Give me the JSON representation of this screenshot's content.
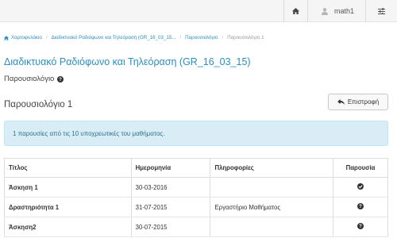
{
  "topbar": {
    "home_icon": "home-icon",
    "user_icon": "user-icon",
    "username": "math1",
    "settings_icon": "sliders-icon"
  },
  "breadcrumb": {
    "items": [
      "Χαρτοφυλάκιο",
      "Διαδικτυακό Ραδιόφωνο και Τηλεόραση (GR_16_03_15...",
      "Παρουσιολόγιο",
      "Παρουσιολόγιο 1"
    ]
  },
  "course": {
    "title": "Διαδικτυακό Ραδιόφωνο και Τηλεόραση (GR_16_03_15)",
    "section": "Παρουσιολόγιο"
  },
  "page": {
    "title": "Παρουσιολόγιο 1",
    "back_label": "Επιστροφή"
  },
  "alert": {
    "text": "1 παρουσίες από τις 10 υποχρεωτικές του μαθήματος."
  },
  "table": {
    "headers": [
      "Τίτλος",
      "Ημερομηνία",
      "Πληροφορίες",
      "Παρουσία"
    ],
    "rows": [
      {
        "title": "Άσκηση 1",
        "date": "30-03-2016",
        "info": "",
        "presence": "check-icon"
      },
      {
        "title": "Δραστηριότητα 1",
        "date": "31-07-2015",
        "info": "Εργαστήριο Μαθήματος",
        "presence": "question-icon"
      },
      {
        "title": "Άσκηση2",
        "date": "30-07-2015",
        "info": "",
        "presence": "question-icon"
      }
    ]
  },
  "colors": {
    "link": "#2a8fc4",
    "alert_bg": "#d9edf7",
    "alert_text": "#31708f"
  }
}
